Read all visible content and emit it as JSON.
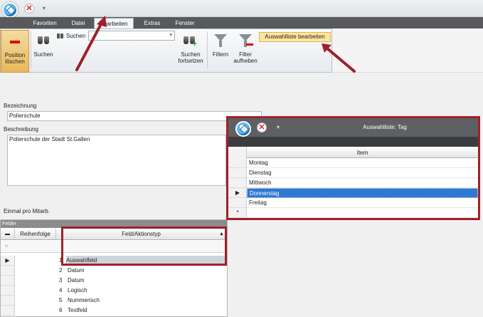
{
  "ribbon": {
    "tabs": [
      "Favoriten",
      "Datei",
      "Bearbeiten",
      "Extras",
      "Fenster"
    ],
    "active_tab": "Bearbeiten",
    "position_loeschen": "Position löschen",
    "suchen_small": "Suchen",
    "suchen": "Suchen",
    "suchen_fortsetzen": "Suchen fortsetzen",
    "filtern": "Filtern",
    "filter_aufheben": "Filter aufheben",
    "auswahlliste_bearbeiten": "Auswahlliste bearbeiten"
  },
  "form": {
    "bezeichnung_label": "Bezeichnung",
    "bezeichnung_value": "Polierschule",
    "beschreibung_label": "Beschreibung",
    "beschreibung_value": "Polierschule der Stadt St.Gallen",
    "einmal_label": "Einmal pro Mitarb."
  },
  "felder": {
    "title": "Felder",
    "columns": [
      "Reihenfolge",
      "Feld/Aktionstyp"
    ],
    "rows": [
      {
        "order": "1",
        "type": "Auswahlfeld"
      },
      {
        "order": "2",
        "type": "Datum"
      },
      {
        "order": "3",
        "type": "Datum"
      },
      {
        "order": "4",
        "type": "Logisch"
      },
      {
        "order": "5",
        "type": "Nummerisch"
      },
      {
        "order": "6",
        "type": "Textfeld"
      }
    ]
  },
  "window": {
    "title": "Auswahlliste: Tag",
    "column": "Item",
    "items": [
      "Montag",
      "Dienstag",
      "Mittwoch",
      "Donnerstag",
      "Freitag"
    ],
    "selected": "Donnerstag",
    "new_row_marker": "*",
    "current_row_marker": "▶"
  },
  "icons": {
    "app": "app-cube-icon",
    "close": "close-x-icon",
    "binoculars": "binoculars-icon",
    "filter": "funnel-icon"
  },
  "colors": {
    "annotation": "#a0202a",
    "selection": "#2f78d4",
    "tabstrip": "#58595b",
    "highlight_button": "#fde6a0"
  }
}
